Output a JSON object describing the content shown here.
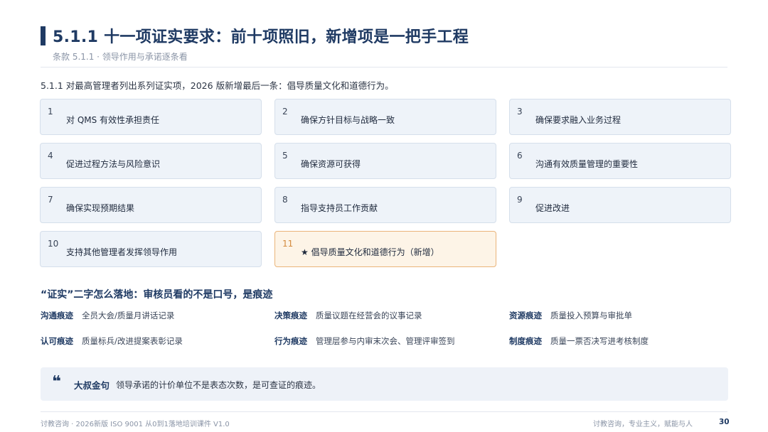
{
  "header": {
    "title": "5.1.1 十一项证实要求：前十项照旧，新增项是一把手工程",
    "subtitle": "条款 5.1.1 · 领导作用与承诺逐条看"
  },
  "intro": "5.1.1 对最高管理者列出系列证实项，2026 版新增最后一条：倡导质量文化和道德行为。",
  "items": [
    {
      "num": "1",
      "label": "对 QMS 有效性承担责任"
    },
    {
      "num": "2",
      "label": "确保方针目标与战略一致"
    },
    {
      "num": "3",
      "label": "确保要求融入业务过程"
    },
    {
      "num": "4",
      "label": "促进过程方法与风险意识"
    },
    {
      "num": "5",
      "label": "确保资源可获得"
    },
    {
      "num": "6",
      "label": "沟通有效质量管理的重要性"
    },
    {
      "num": "7",
      "label": "确保实现预期结果"
    },
    {
      "num": "8",
      "label": "指导支持员工作贡献"
    },
    {
      "num": "9",
      "label": "促进改进"
    },
    {
      "num": "10",
      "label": "支持其他管理者发挥领导作用"
    },
    {
      "num": "11",
      "label": "★ 倡导质量文化和道德行为（新增）"
    }
  ],
  "evidence": {
    "heading": "“证实”二字怎么落地：审核员看的不是口号，是痕迹",
    "traces": [
      {
        "key": "沟通痕迹",
        "value": "全员大会/质量月讲话记录"
      },
      {
        "key": "决策痕迹",
        "value": "质量议题在经营会的议事记录"
      },
      {
        "key": "资源痕迹",
        "value": "质量投入预算与审批单"
      },
      {
        "key": "认可痕迹",
        "value": "质量标兵/改进提案表彰记录"
      },
      {
        "key": "行为痕迹",
        "value": "管理层参与内审末次会、管理评审签到"
      },
      {
        "key": "制度痕迹",
        "value": "质量一票否决写进考核制度"
      }
    ]
  },
  "quote": {
    "mark": "❝",
    "tag": "大叔金句",
    "text": "领导承诺的计价单位不是表态次数，是可查证的痕迹。"
  },
  "footer": {
    "left": "讨教咨询 · 2026新版 ISO 9001 从0到1落地培训课件 V1.0",
    "right": "讨教咨询，专业主义，赋能与人",
    "page": "30"
  },
  "colors": {
    "accent": "#1f3a63",
    "card_bg": "#eef3f9",
    "highlight_bg": "#fdf4e7",
    "highlight_border": "#eab47a"
  }
}
